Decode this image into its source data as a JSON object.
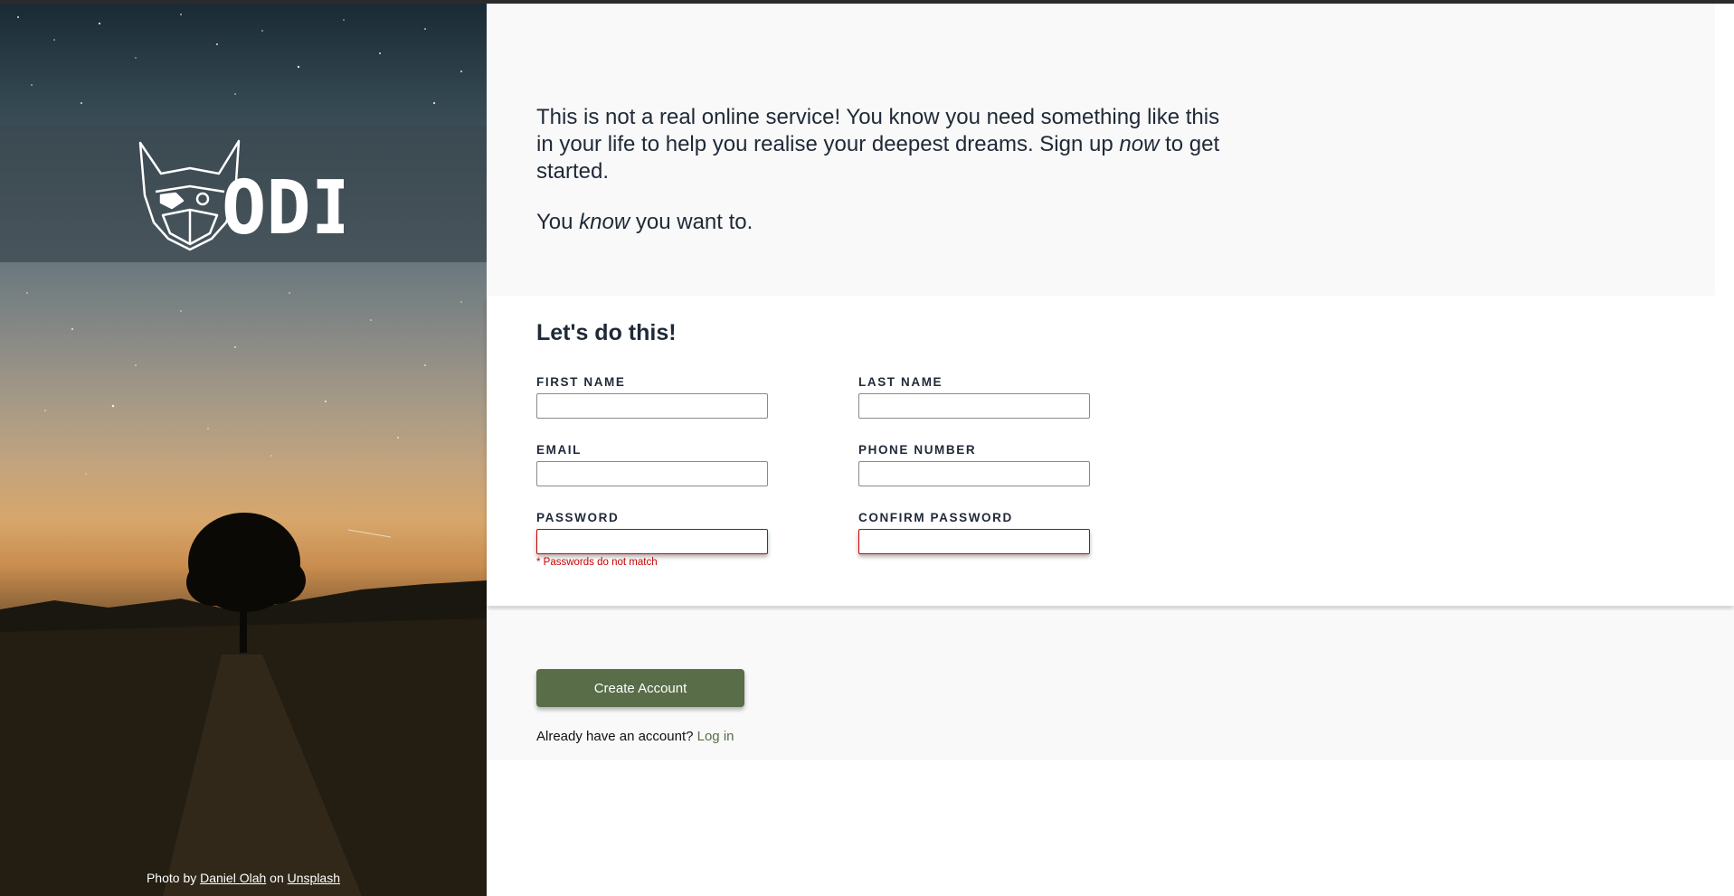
{
  "brand": {
    "logo_text": "ODIN"
  },
  "hero": {
    "credit_prefix": "Photo by",
    "credit_author": "Daniel Olah",
    "credit_middle": "on",
    "credit_source": "Unsplash"
  },
  "intro": {
    "line1": "This is not a real online service! You know you need something like this in your life to help you realise your deepest dreams. Sign up",
    "line1_em": "now",
    "line1_end": "to get started.",
    "line2_start": "You",
    "line2_em": "know",
    "line2_end": "you want to."
  },
  "form": {
    "title": "Let's do this!",
    "first_name_label": "First Name",
    "last_name_label": "Last Name",
    "email_label": "Email",
    "phone_label": "Phone Number",
    "password_label": "Password",
    "confirm_label": "Confirm Password",
    "password_error": "* Passwords do not match"
  },
  "actions": {
    "create_label": "Create Account",
    "login_prompt": "Already have an account?",
    "login_link": "Log in"
  },
  "colors": {
    "accent": "#596d48",
    "error": "#cc0000",
    "panel_bg": "#f9f9f9"
  }
}
